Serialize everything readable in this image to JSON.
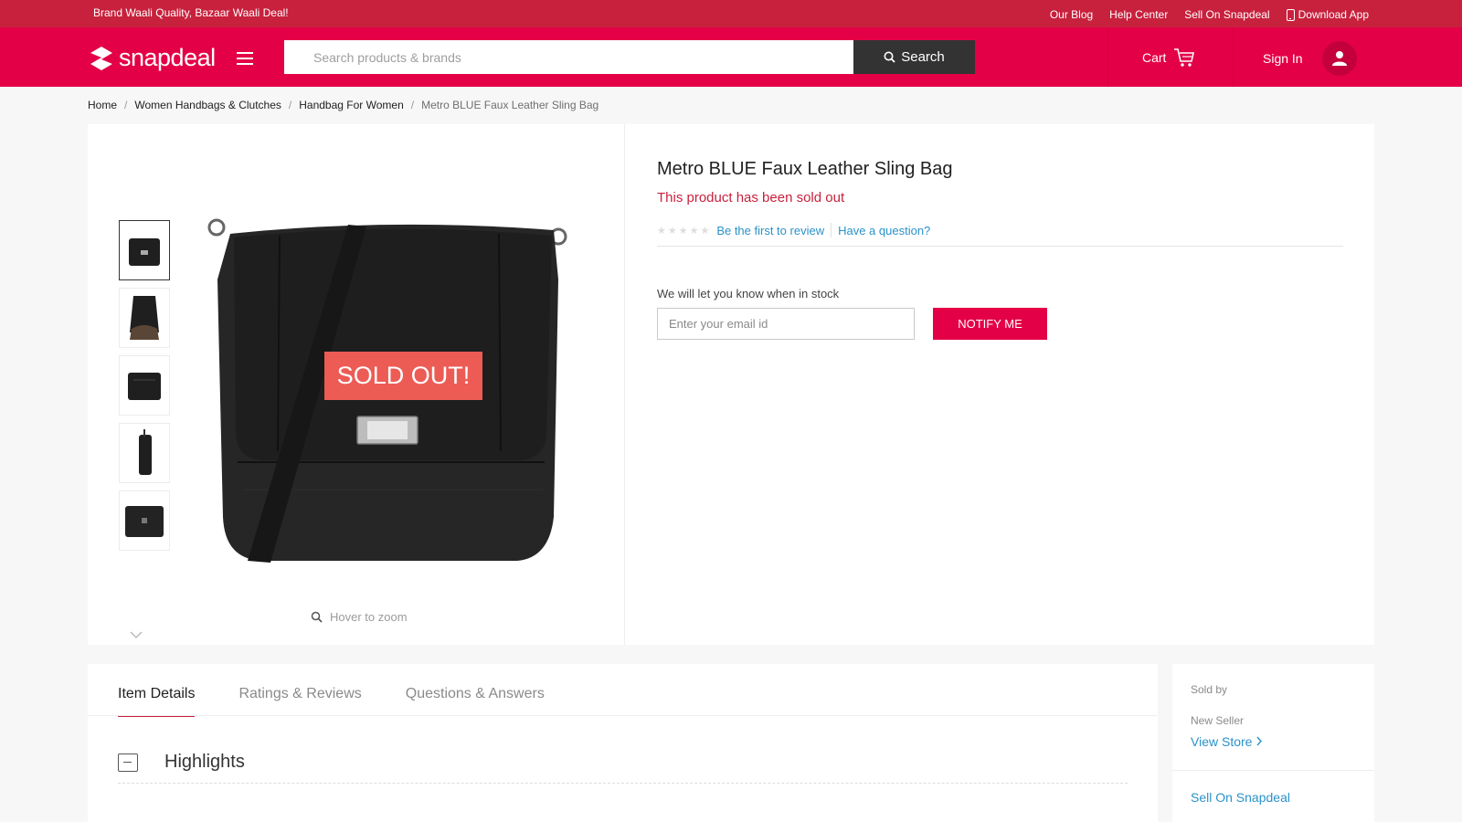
{
  "top_strip": {
    "tagline": "Brand Waali Quality, Bazaar Waali Deal!",
    "links": [
      "Our Blog",
      "Help Center",
      "Sell On Snapdeal"
    ],
    "download_app": "Download App"
  },
  "header": {
    "logo_text": "snapdeal",
    "search_placeholder": "Search products & brands",
    "search_button": "Search",
    "cart_label": "Cart",
    "signin_label": "Sign In"
  },
  "breadcrumb": {
    "items": [
      "Home",
      "Women Handbags & Clutches",
      "Handbag For Women"
    ],
    "current": "Metro BLUE Faux Leather Sling Bag",
    "separator": "/"
  },
  "product": {
    "title": "Metro BLUE Faux Leather Sling Bag",
    "status": "This product has been sold out",
    "rating_stars": "★★★★★",
    "review_link": "Be the first to review",
    "question_link": "Have a question?",
    "sold_out_badge": "SOLD OUT!",
    "hover_zoom": "Hover to zoom",
    "thumbnail_count": 5
  },
  "notify": {
    "label": "We will let you know when in stock",
    "email_placeholder": "Enter your email id",
    "button": "NOTIFY ME"
  },
  "details": {
    "tabs": [
      "Item Details",
      "Ratings & Reviews",
      "Questions & Answers"
    ],
    "active_tab": "Item Details",
    "section_title": "Highlights"
  },
  "seller": {
    "sold_by_label": "Sold by",
    "seller_name": "New Seller",
    "view_store": "View Store",
    "sell_on": "Sell On Snapdeal"
  },
  "colors": {
    "brand_red": "#e40046",
    "top_strip": "#c8213d",
    "sold_out_badge": "#ec5c55",
    "link_blue": "#2b92c9"
  }
}
